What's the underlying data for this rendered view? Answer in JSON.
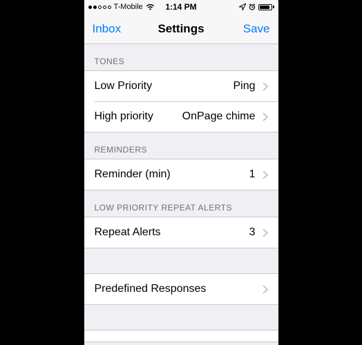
{
  "statusBar": {
    "carrier": "T-Mobile",
    "time": "1:14 PM"
  },
  "navBar": {
    "left": "Inbox",
    "title": "Settings",
    "right": "Save"
  },
  "sections": {
    "tones": {
      "header": "TONES",
      "lowPriority": {
        "label": "Low Priority",
        "value": "Ping"
      },
      "highPriority": {
        "label": "High priority",
        "value": "OnPage chime"
      }
    },
    "reminders": {
      "header": "REMINDERS",
      "reminder": {
        "label": "Reminder (min)",
        "value": "1"
      }
    },
    "lowPriorityRepeat": {
      "header": "LOW PRIORITY REPEAT ALERTS",
      "repeat": {
        "label": "Repeat Alerts",
        "value": "3"
      }
    },
    "predefined": {
      "label": "Predefined Responses"
    }
  },
  "colors": {
    "accent": "#007aff",
    "groupBg": "#efeff4",
    "separator": "#c8c7cc",
    "headerText": "#6d6d72"
  }
}
